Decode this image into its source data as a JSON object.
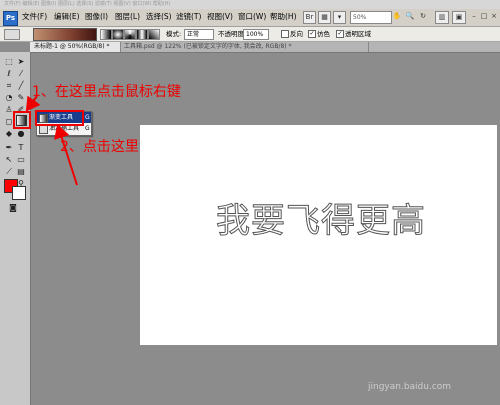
{
  "app": {
    "logo_label": "Ps",
    "menus": [
      "文件(F)",
      "编辑(E)",
      "图像(I)",
      "图层(L)",
      "选择(S)",
      "滤镜(T)",
      "视图(V)",
      "窗口(W)",
      "帮助(H)"
    ],
    "zoom_level": "50%",
    "ghost_text": "文件(F) 编辑(E) 图像(I) 图层(L) 选择(S) 滤镜(T) 视图(V) 窗口(W) 帮助(H)"
  },
  "options": {
    "mode_label": "模式:",
    "mode_value": "正常",
    "opacity_label": "不透明度:",
    "opacity_value": "100%",
    "reverse_label": "反向",
    "dither_label": "仿色",
    "transparency_label": "透明区域"
  },
  "tabs": [
    {
      "label": "未标题-1 @ 50%(RGB/8) *",
      "active": true
    },
    {
      "label": "工具箱.psd @ 122% (已被锁定文字的字体, 我会改, RGB/8) *",
      "active": false
    }
  ],
  "flyout": {
    "items": [
      {
        "label": "渐变工具",
        "key": "G",
        "selected": true
      },
      {
        "label": "油漆桶工具",
        "key": "G",
        "selected": false
      }
    ]
  },
  "canvas": {
    "text": "我要飞得更高"
  },
  "annotations": {
    "step1": "1、在这里点击鼠标右键",
    "step2": "2、点击这里"
  },
  "colors": {
    "foreground": "#ff0000",
    "background": "#ffffff",
    "annotation": "#e00000",
    "flyout_selected": "#1a3e8c"
  },
  "watermark": {
    "text": "jingyan.baidu.com"
  }
}
